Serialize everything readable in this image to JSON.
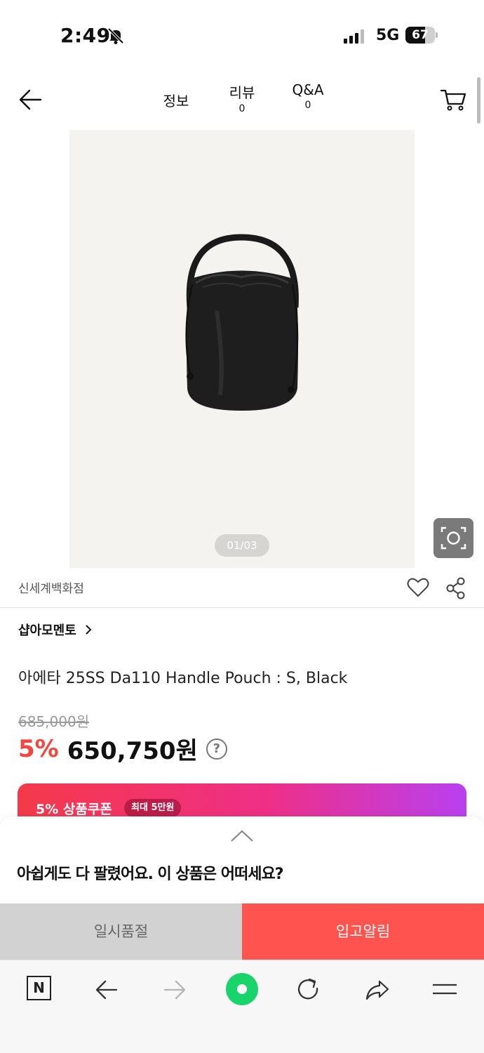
{
  "status_bar": {
    "time": "2:49",
    "network": "5G",
    "battery_level": "67",
    "battery_fraction": 0.67,
    "icons": [
      "bell-slash-icon",
      "cellular-signal-icon",
      "battery-icon"
    ]
  },
  "header": {
    "tabs": [
      {
        "label": "정보",
        "count": ""
      },
      {
        "label": "리뷰",
        "count": "0"
      },
      {
        "label": "Q&A",
        "count": "0"
      }
    ],
    "icons": [
      "back-arrow-icon",
      "cart-icon"
    ]
  },
  "gallery": {
    "page_indicator": "01/03",
    "background": "#f4f3ef",
    "icons": [
      "image-search-lens-icon"
    ]
  },
  "seller": {
    "name": "신세계백화점",
    "icons": [
      "heart-icon",
      "share-icon"
    ]
  },
  "store": {
    "name": "샵아모멘토"
  },
  "product": {
    "title": "아에타 25SS Da110 Handle Pouch : S, Black",
    "original_price": "685,000원",
    "discount": "5%",
    "sale_price": "650,750원",
    "help_symbol": "?"
  },
  "coupon": {
    "title": "5% 상품쿠폰",
    "badge": "최대 5만원"
  },
  "sheet": {
    "message": "아쉽게도 다 팔렸어요. 이 상품은 어떠세요?",
    "soldout_label": "일시품절",
    "notify_label": "입고알림"
  },
  "toolbar": {
    "home_label": "N",
    "icons": [
      "naver-home-icon",
      "back-icon",
      "forward-icon",
      "green-dot-icon",
      "reload-icon",
      "share-arrow-icon",
      "menu-icon"
    ]
  },
  "colors": {
    "accent_red": "#f4463f",
    "notify_button": "#fe534e",
    "soldout_button": "#d2d2d2",
    "coupon_gradient_start": "#f5394a",
    "coupon_gradient_end": "#b940f0",
    "green_button": "#19d46a"
  }
}
